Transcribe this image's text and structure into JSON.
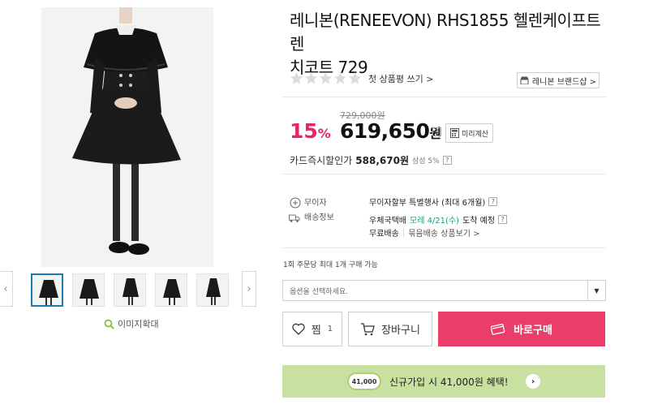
{
  "product": {
    "title_line1": "레니본(RENEEVON) RHS1855 헬렌케이프트렌",
    "title_line2": "치코트 729",
    "review_link": "첫 상품평 쓰기 >",
    "brand_shop": "레니본 브랜드샵 >"
  },
  "gallery": {
    "zoom_label": "이미지확대",
    "thumb_count": 5
  },
  "price": {
    "original": "729,000원",
    "discount_number": "15",
    "discount_unit": "%",
    "sale_number": "619,650",
    "sale_unit": "원",
    "help_mark": "?",
    "calc_label": "미리계산",
    "card_label": "카드즉시할인가",
    "card_amount": "588,670원",
    "card_sub": "삼성 5%"
  },
  "benefits": {
    "interest_label": "무이자",
    "shipping_label": "배송정보",
    "interest_text": "무이자할부 특별행사 (최대 6개월)",
    "ship_prefix": "우체국택배",
    "ship_date": "모레 4/21(수)",
    "ship_suffix": "도착 예정",
    "free_shipping": "무료배송",
    "bundle_link": "묶음배송 상품보기 >"
  },
  "order": {
    "limit_note": "1회 주문당 최대 1개 구매 가능",
    "option_placeholder": "옵션을 선택하세요.",
    "wish_label": "찜",
    "wish_count": "1",
    "cart_label": "장바구니",
    "buy_label": "바로구매"
  },
  "promo": {
    "coin_text": "41,000",
    "text": "신규가입 시 41,000원 혜택!"
  },
  "colors": {
    "accent_pink": "#e7256b",
    "buy_button": "#ea3d69",
    "promo_bg": "#c8e1a0",
    "ship_date": "#14a08a",
    "active_thumb": "#1b7bb4"
  }
}
